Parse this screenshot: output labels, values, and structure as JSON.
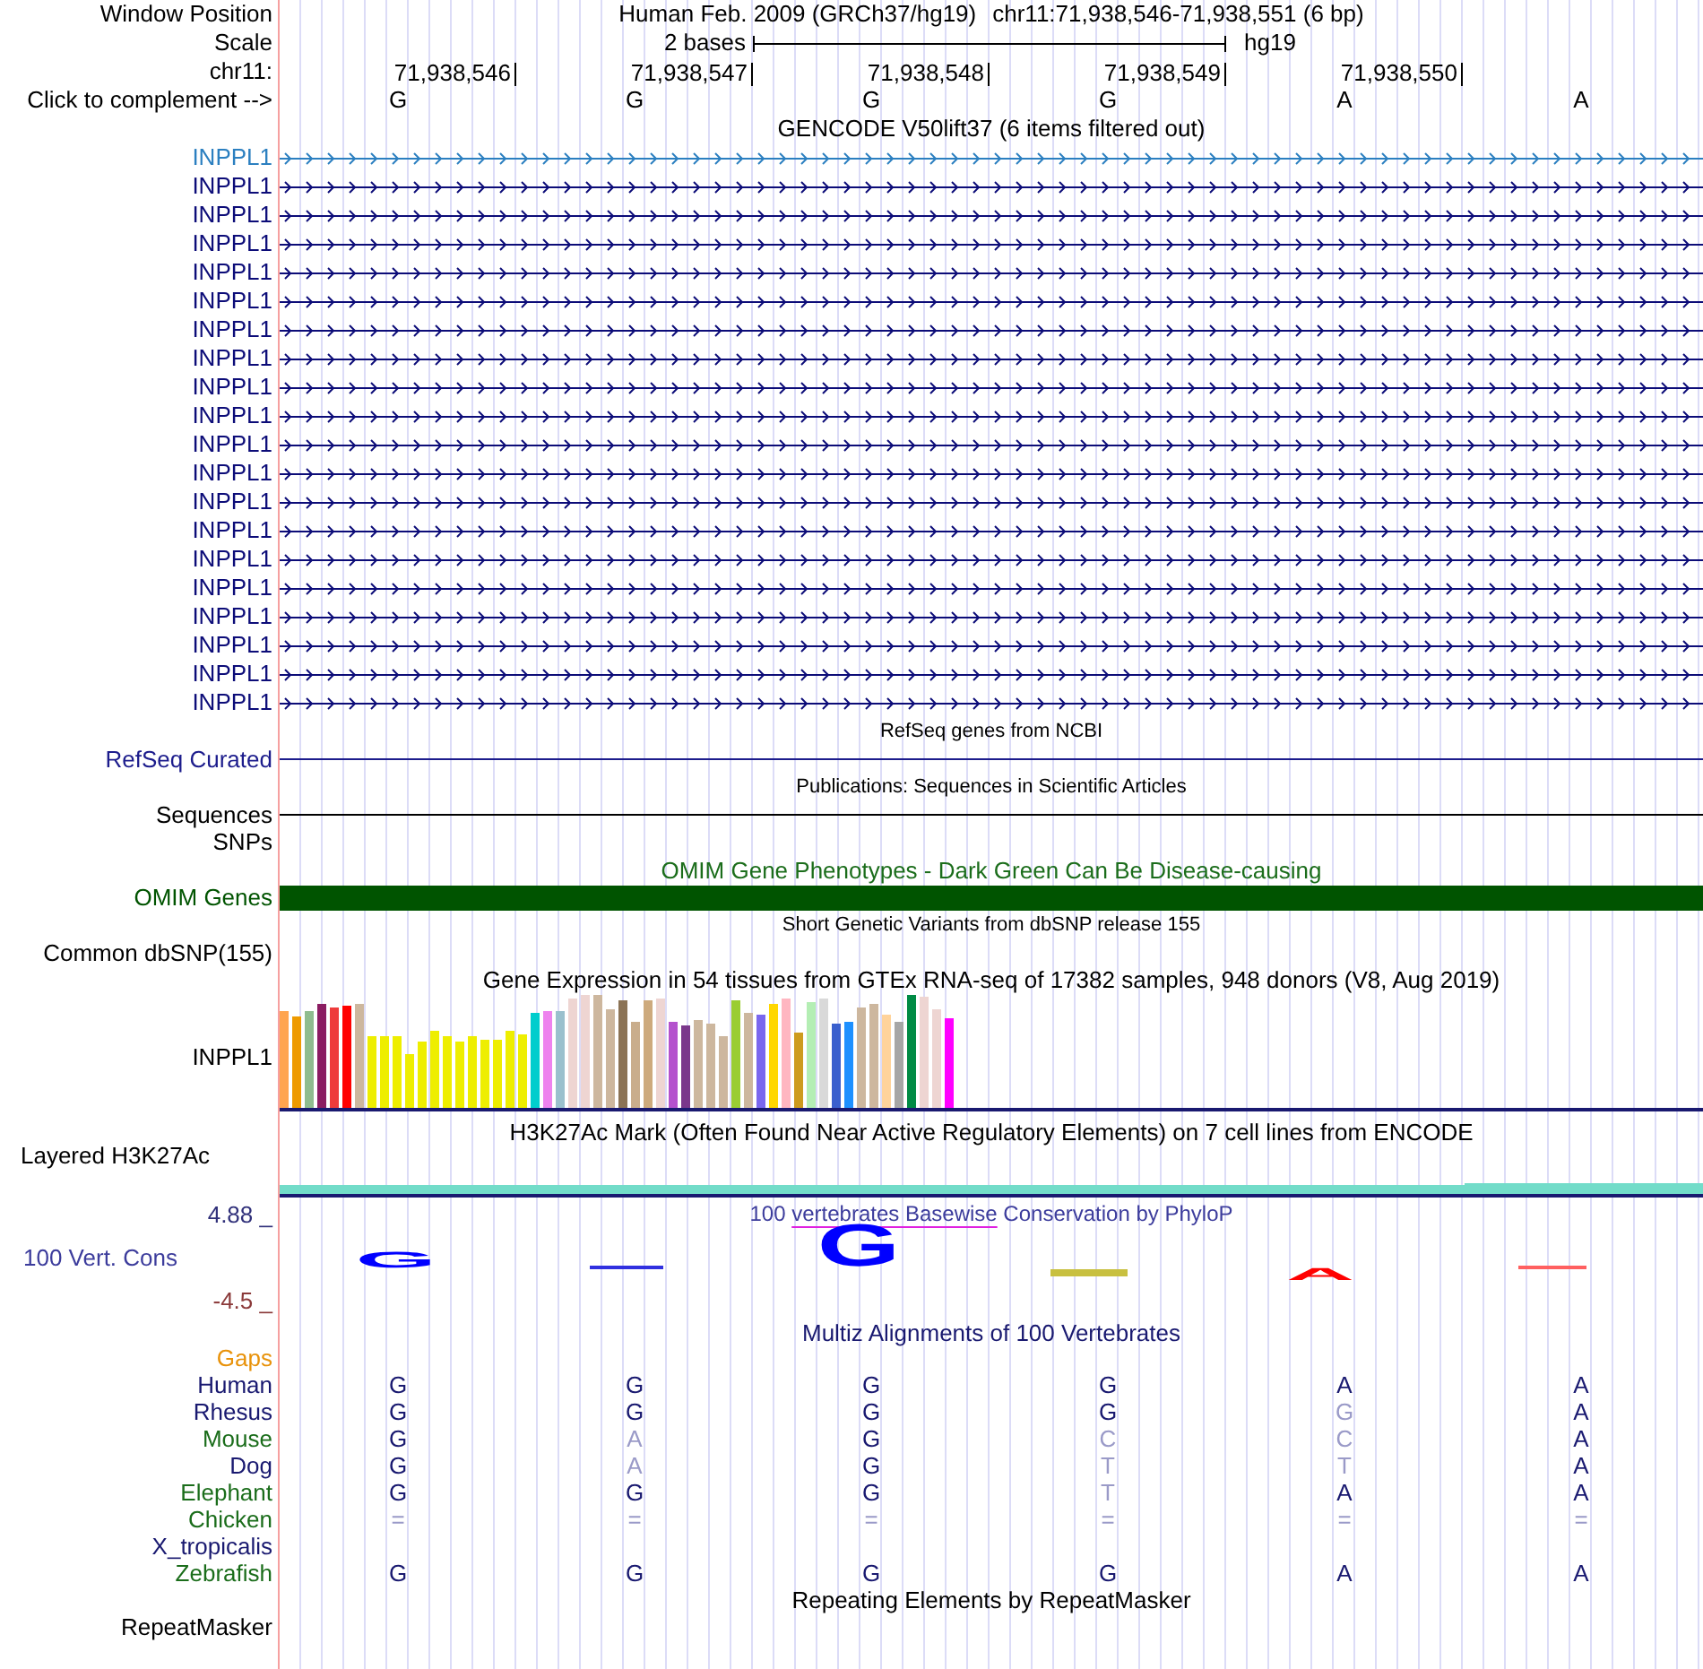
{
  "header": {
    "window_label": "Window Position",
    "assembly": "Human Feb. 2009 (GRCh37/hg19)",
    "position": "chr11:71,938,546-71,938,551 (6 bp)",
    "scale_label": "Scale",
    "scale_text": "2 bases",
    "scale_db": "hg19",
    "chrom_label": "chr11:",
    "ruler": [
      "71,938,546",
      "71,938,547",
      "71,938,548",
      "71,938,549",
      "71,938,550"
    ],
    "complement_label": "Click to complement -->",
    "bases": [
      "G",
      "G",
      "G",
      "G",
      "A",
      "A"
    ]
  },
  "tracks": [
    {
      "kind": "transcripts",
      "title": "GENCODE V50lift37 (6 items filtered out)",
      "items": [
        {
          "name": "INPPL1",
          "color": "#2b7fc0"
        },
        {
          "name": "INPPL1",
          "color": "#0c0c78"
        },
        {
          "name": "INPPL1",
          "color": "#0c0c78"
        },
        {
          "name": "INPPL1",
          "color": "#0c0c78"
        },
        {
          "name": "INPPL1",
          "color": "#0c0c78"
        },
        {
          "name": "INPPL1",
          "color": "#0c0c78"
        },
        {
          "name": "INPPL1",
          "color": "#0c0c78"
        },
        {
          "name": "INPPL1",
          "color": "#0c0c78"
        },
        {
          "name": "INPPL1",
          "color": "#0c0c78"
        },
        {
          "name": "INPPL1",
          "color": "#0c0c78"
        },
        {
          "name": "INPPL1",
          "color": "#0c0c78"
        },
        {
          "name": "INPPL1",
          "color": "#0c0c78"
        },
        {
          "name": "INPPL1",
          "color": "#0c0c78"
        },
        {
          "name": "INPPL1",
          "color": "#0c0c78"
        },
        {
          "name": "INPPL1",
          "color": "#0c0c78"
        },
        {
          "name": "INPPL1",
          "color": "#0c0c78"
        },
        {
          "name": "INPPL1",
          "color": "#0c0c78"
        },
        {
          "name": "INPPL1",
          "color": "#0c0c78"
        },
        {
          "name": "INPPL1",
          "color": "#0c0c78"
        },
        {
          "name": "INPPL1",
          "color": "#0c0c78"
        }
      ]
    },
    {
      "kind": "features",
      "title": "RefSeq genes from NCBI",
      "rows": [
        {
          "label": "RefSeq Curated",
          "kind": "line",
          "color": "#1c1c8c"
        }
      ]
    },
    {
      "kind": "features",
      "title": "Publications: Sequences in Scientific Articles",
      "rows": [
        {
          "label": "Sequences",
          "kind": "line",
          "color": "#000000"
        },
        {
          "label": "SNPs",
          "kind": "empty"
        }
      ]
    },
    {
      "kind": "phenotypes",
      "title": "OMIM Gene Phenotypes - Dark Green Can Be Disease-causing",
      "rows": [
        {
          "label": "OMIM Genes",
          "kind": "bar",
          "color": "#005400"
        }
      ]
    },
    {
      "kind": "features",
      "title": "Short Genetic Variants from dbSNP release 155",
      "rows": [
        {
          "label": "Common dbSNP(155)",
          "kind": "empty"
        }
      ]
    },
    {
      "kind": "expression",
      "title": "Gene Expression in 54 tissues from GTEx RNA-seq of 17382 samples, 948 donors (V8, Aug 2019)",
      "label": "INPPL1"
    },
    {
      "kind": "signal",
      "title": "H3K27Ac Mark (Often Found Near Active Regulatory Elements) on 7 cell lines from ENCODE",
      "label": "Layered H3K27Ac"
    },
    {
      "kind": "conservation",
      "title": "100",
      "title_link": "vertebrates Basewise",
      "title_end": "Conservation by PhyloP",
      "label": "100 Vert. Cons",
      "axis_max": "4.88 _",
      "axis_min": "-4.5 _",
      "logo": [
        {
          "kind": "letter",
          "text": "G",
          "color": "#0000ff"
        },
        {
          "kind": "bar",
          "color": "#3030e0"
        },
        {
          "kind": "letter",
          "text": "G",
          "color": "#0000ff"
        },
        {
          "kind": "bar",
          "color": "#c8c040"
        },
        {
          "kind": "letter",
          "text": "A",
          "color": "#ff0000"
        },
        {
          "kind": "bar",
          "color": "#ff6060"
        }
      ]
    },
    {
      "kind": "alignment",
      "title": "Multiz Alignments of 100 Vertebrates",
      "rows": [
        {
          "label": "Gaps",
          "color": "#e8920a"
        },
        {
          "label": "Human",
          "color": "#191970",
          "bases": [
            {
              "text": "G",
              "dim": false
            },
            {
              "text": "G",
              "dim": false
            },
            {
              "text": "G",
              "dim": false
            },
            {
              "text": "G",
              "dim": false
            },
            {
              "text": "A",
              "dim": false
            },
            {
              "text": "A",
              "dim": false
            }
          ]
        },
        {
          "label": "Rhesus",
          "color": "#191970",
          "bases": [
            {
              "text": "G",
              "dim": false
            },
            {
              "text": "G",
              "dim": false
            },
            {
              "text": "G",
              "dim": false
            },
            {
              "text": "G",
              "dim": false
            },
            {
              "text": "G",
              "dim": true
            },
            {
              "text": "A",
              "dim": false
            }
          ]
        },
        {
          "label": "Mouse",
          "color": "#1b6d1b",
          "bases": [
            {
              "text": "G",
              "dim": false
            },
            {
              "text": "A",
              "dim": true
            },
            {
              "text": "G",
              "dim": false
            },
            {
              "text": "C",
              "dim": true
            },
            {
              "text": "C",
              "dim": true
            },
            {
              "text": "A",
              "dim": false
            }
          ]
        },
        {
          "label": "Dog",
          "color": "#191970",
          "bases": [
            {
              "text": "G",
              "dim": false
            },
            {
              "text": "A",
              "dim": true
            },
            {
              "text": "G",
              "dim": false
            },
            {
              "text": "T",
              "dim": true
            },
            {
              "text": "T",
              "dim": true
            },
            {
              "text": "A",
              "dim": false
            }
          ]
        },
        {
          "label": "Elephant",
          "color": "#1b6d1b",
          "bases": [
            {
              "text": "G",
              "dim": false
            },
            {
              "text": "G",
              "dim": false
            },
            {
              "text": "G",
              "dim": false
            },
            {
              "text": "T",
              "dim": true
            },
            {
              "text": "A",
              "dim": false
            },
            {
              "text": "A",
              "dim": false
            }
          ]
        },
        {
          "label": "Chicken",
          "color": "#1b6d1b",
          "bases": [
            {
              "text": "=",
              "dim": true
            },
            {
              "text": "=",
              "dim": true
            },
            {
              "text": "=",
              "dim": true
            },
            {
              "text": "=",
              "dim": true
            },
            {
              "text": "=",
              "dim": true
            },
            {
              "text": "=",
              "dim": true
            }
          ]
        },
        {
          "label": "X_tropicalis",
          "color": "#191970"
        },
        {
          "label": "Zebrafish",
          "color": "#1b6d1b",
          "bases": [
            {
              "text": "G",
              "dim": false
            },
            {
              "text": "G",
              "dim": false
            },
            {
              "text": "G",
              "dim": false
            },
            {
              "text": "G",
              "dim": false
            },
            {
              "text": "A",
              "dim": false
            },
            {
              "text": "A",
              "dim": false
            }
          ]
        }
      ]
    },
    {
      "kind": "repeats",
      "title": "Repeating Elements by RepeatMasker",
      "rows": [
        {
          "label": "RepeatMasker",
          "kind": "empty"
        }
      ]
    }
  ]
}
